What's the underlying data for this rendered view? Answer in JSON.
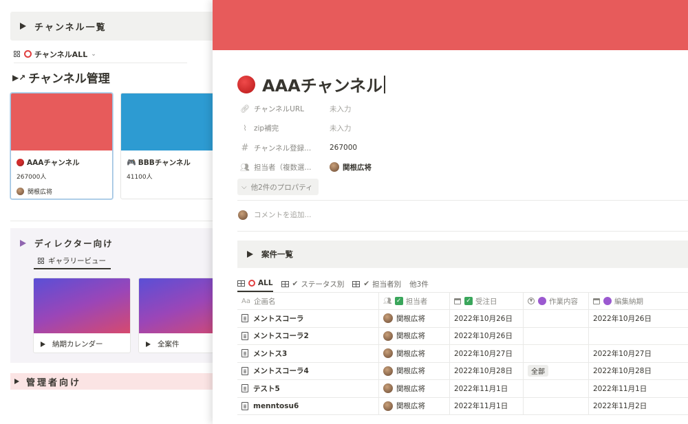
{
  "left": {
    "channel_list_toggle": "チャンネル一覧",
    "view_selector": "チャンネルALL",
    "section_title": "チャンネル管理",
    "cards": [
      {
        "name": "AAAチャンネル",
        "count": "267000人",
        "owner": "関根広将",
        "cover": "#e75b5b"
      },
      {
        "name": "BBBチャンネル",
        "count": "41100人",
        "owner": "",
        "cover": "#2d9bd2"
      }
    ],
    "director_toggle": "ディレクター向け",
    "gallery_view_tab": "ギャラリービュー",
    "gallery_cards": [
      {
        "label": "納期カレンダー"
      },
      {
        "label": "全案件"
      }
    ],
    "admin_toggle": "管理者向け"
  },
  "page": {
    "cover_color": "#e75b5b",
    "title": "AAAチャンネル",
    "properties": [
      {
        "icon": "link-icon",
        "name": "チャンネルURL",
        "value": "未入力",
        "empty": true
      },
      {
        "icon": "paperclip-icon",
        "name": "zip補完",
        "value": "未入力",
        "empty": true
      },
      {
        "icon": "hash-icon",
        "name": "チャンネル登録...",
        "value": "267000",
        "empty": false
      },
      {
        "icon": "people-icon",
        "name": "担当者（複数選...",
        "value": "関根広将",
        "empty": false
      }
    ],
    "more_props": "他2件のプロパティ",
    "comment_placeholder": "コメントを追加...",
    "cases_toggle": "案件一覧",
    "view_tabs": [
      {
        "label": "ALL",
        "icon": "ring-icon"
      },
      {
        "label": "ステータス別",
        "icon": "checkmark-icon"
      },
      {
        "label": "担当者別",
        "icon": "checkmark-icon"
      },
      {
        "label": "他3件",
        "icon": ""
      }
    ],
    "table": {
      "headers": [
        "企画名",
        "担当者",
        "受注日",
        "作業内容",
        "編集納期"
      ],
      "rows": [
        {
          "name": "メントスコーラ",
          "owner": "関根広将",
          "order_date": "2022年10月26日",
          "work": "",
          "deadline": "2022年10月26日"
        },
        {
          "name": "メントスコーラ2",
          "owner": "関根広将",
          "order_date": "2022年10月26日",
          "work": "",
          "deadline": ""
        },
        {
          "name": "メントス3",
          "owner": "関根広将",
          "order_date": "2022年10月27日",
          "work": "",
          "deadline": "2022年10月27日"
        },
        {
          "name": "メントスコーラ4",
          "owner": "関根広将",
          "order_date": "2022年10月28日",
          "work": "全部",
          "deadline": "2022年10月28日"
        },
        {
          "name": "テスト5",
          "owner": "関根広将",
          "order_date": "2022年11月1日",
          "work": "",
          "deadline": "2022年11月1日"
        },
        {
          "name": "menntosu6",
          "owner": "関根広将",
          "order_date": "2022年11月1日",
          "work": "",
          "deadline": "2022年11月2日"
        }
      ]
    }
  }
}
